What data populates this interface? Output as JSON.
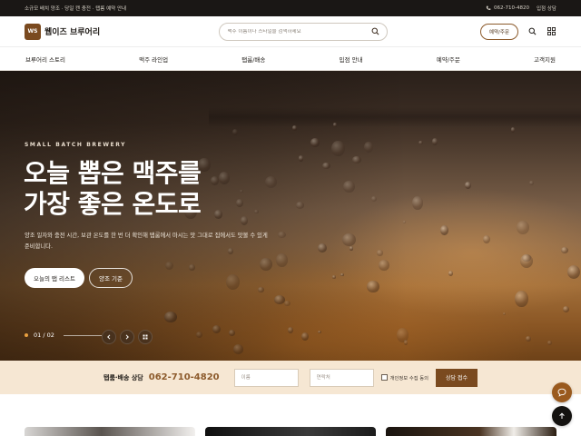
{
  "topbar": {
    "tagline": "소규모 배치 양조 · 당일 캔 충전 · 탭룸 예약 안내",
    "phone": "062-710-4820",
    "link": "입점 상담"
  },
  "header": {
    "logo_mark": "WS",
    "brand": "웹이즈 브루어리",
    "search_placeholder": "맥주 이름이나 스타일을 검색하세요",
    "order_label": "예약/주문"
  },
  "nav": {
    "items": [
      "브루어리 스토리",
      "맥주 라인업",
      "탭룸/배송",
      "입점 안내",
      "예약/주문",
      "고객지원"
    ]
  },
  "hero": {
    "eyebrow": "SMALL BATCH BREWERY",
    "headline_line1": "오늘 뽑은 맥주를",
    "headline_line2": "가장 좋은 온도로",
    "subtext": "양조 일자와 충전 시간, 보관 온도를 한 번 더 확인해 탭룸에서 마시는 맛 그대로 집에서도 맛볼 수 있게 준비합니다.",
    "cta_primary": "오늘의 탭 리스트",
    "cta_secondary": "양조 기준",
    "pager": "01 / 02"
  },
  "consult": {
    "label": "탭룸·배송 상담",
    "phone": "062-710-4820",
    "name_placeholder": "이름",
    "contact_placeholder": "연락처",
    "agree_label": "개인정보 수집 동의",
    "submit_label": "상담 접수"
  },
  "colors": {
    "brand": "#7a4a1f",
    "accent": "#e9a040",
    "consult_bg": "#f6e7d3"
  }
}
